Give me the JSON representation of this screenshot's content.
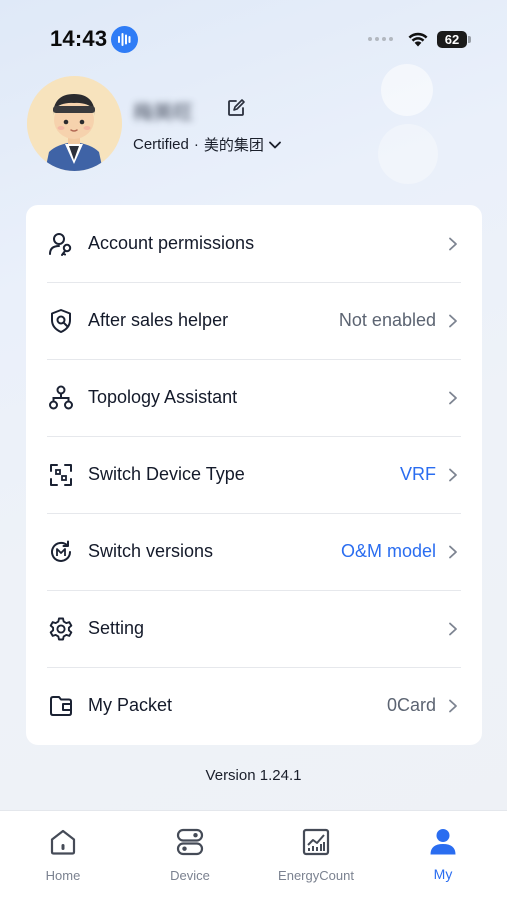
{
  "status_bar": {
    "time": "14:43",
    "battery": "62"
  },
  "profile": {
    "name": "梅美旺",
    "certified": "Certified",
    "separator": "·",
    "organization": "美的集团"
  },
  "menu": [
    {
      "label": "Account permissions",
      "value": "",
      "icon": "user-key-icon"
    },
    {
      "label": "After sales helper",
      "value": "Not enabled",
      "value_color": "grey",
      "icon": "shield-wrench-icon"
    },
    {
      "label": "Topology Assistant",
      "value": "",
      "icon": "topology-icon"
    },
    {
      "label": "Switch Device Type",
      "value": "VRF",
      "value_color": "blue",
      "icon": "scan-frame-icon"
    },
    {
      "label": "Switch versions",
      "value": "O&M model",
      "value_color": "blue",
      "icon": "switch-version-icon"
    },
    {
      "label": "Setting",
      "value": "",
      "icon": "gear-icon"
    },
    {
      "label": "My Packet",
      "value": "0Card",
      "value_color": "grey",
      "icon": "wallet-icon"
    }
  ],
  "version": "Version 1.24.1",
  "tabs": [
    {
      "label": "Home",
      "icon": "home-icon",
      "active": false
    },
    {
      "label": "Device",
      "icon": "device-icon",
      "active": false
    },
    {
      "label": "EnergyCount",
      "icon": "chart-icon",
      "active": false
    },
    {
      "label": "My",
      "icon": "person-icon",
      "active": true
    }
  ],
  "colors": {
    "accent": "#2a6df0",
    "text": "#141a2a",
    "muted": "#5c6472"
  }
}
